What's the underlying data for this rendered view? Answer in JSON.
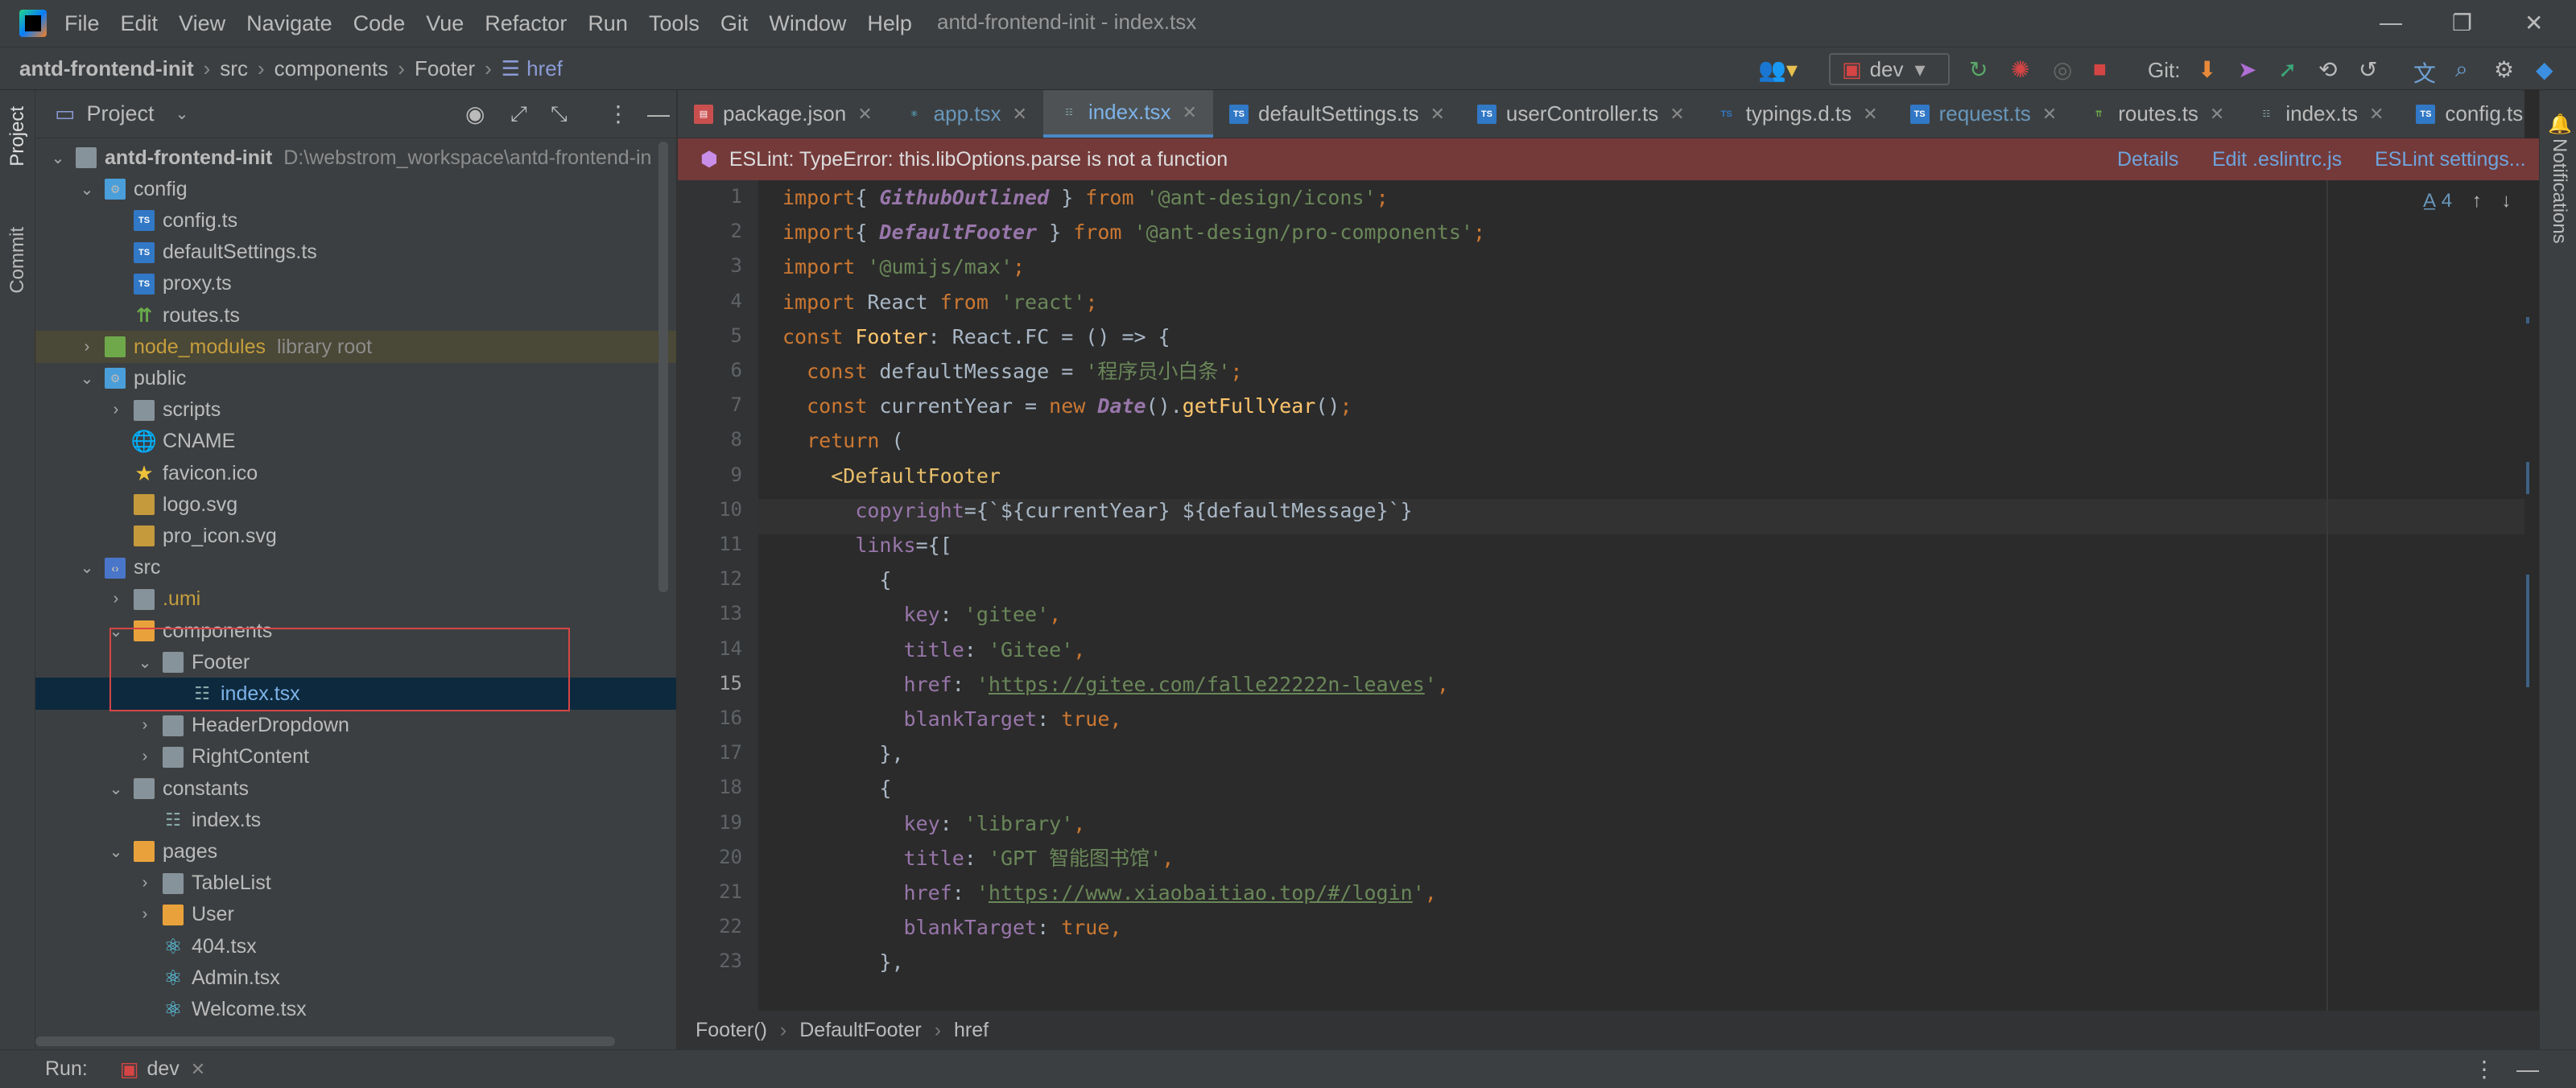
{
  "menubar": {
    "items": [
      "File",
      "Edit",
      "View",
      "Navigate",
      "Code",
      "Vue",
      "Refactor",
      "Run",
      "Tools",
      "Git",
      "Window",
      "Help"
    ],
    "title": "antd-frontend-init - index.tsx"
  },
  "navbar": {
    "crumbs": [
      "antd-frontend-init",
      "src",
      "components",
      "Footer",
      "href"
    ],
    "branch": "dev",
    "git_label": "Git:"
  },
  "leftstrip": {
    "project_tab": "Project",
    "commit_tab": "Commit"
  },
  "rightstrip": {
    "notifications_tab": "Notifications"
  },
  "project": {
    "header": "Project",
    "tree": [
      {
        "label": "antd-frontend-init",
        "extra": "D:\\webstrom_workspace\\antd-frontend-in",
        "depth": 0,
        "arrow": "open",
        "icon": "folder",
        "bold": true
      },
      {
        "label": "config",
        "depth": 1,
        "arrow": "open",
        "icon": "folder-cfg"
      },
      {
        "label": "config.ts",
        "depth": 2,
        "icon": "ts"
      },
      {
        "label": "defaultSettings.ts",
        "depth": 2,
        "icon": "ts"
      },
      {
        "label": "proxy.ts",
        "depth": 2,
        "icon": "ts"
      },
      {
        "label": "routes.ts",
        "depth": 2,
        "icon": "route"
      },
      {
        "label": "node_modules",
        "extra": "library root",
        "depth": 1,
        "arrow": "closed",
        "icon": "folder-green",
        "style": "lib"
      },
      {
        "label": "public",
        "depth": 1,
        "arrow": "open",
        "icon": "folder-cfg"
      },
      {
        "label": "scripts",
        "depth": 2,
        "arrow": "closed",
        "icon": "folder"
      },
      {
        "label": "CNAME",
        "depth": 2,
        "icon": "cname"
      },
      {
        "label": "favicon.ico",
        "depth": 2,
        "icon": "star"
      },
      {
        "label": "logo.svg",
        "depth": 2,
        "icon": "svg"
      },
      {
        "label": "pro_icon.svg",
        "depth": 2,
        "icon": "svg"
      },
      {
        "label": "src",
        "depth": 1,
        "arrow": "open",
        "icon": "folder-src"
      },
      {
        "label": ".umi",
        "depth": 2,
        "arrow": "closed",
        "icon": "folder",
        "style": "orange"
      },
      {
        "label": "components",
        "depth": 2,
        "arrow": "open",
        "icon": "folder-orange"
      },
      {
        "label": "Footer",
        "depth": 3,
        "arrow": "open",
        "icon": "folder"
      },
      {
        "label": "index.tsx",
        "depth": 4,
        "icon": "lines",
        "style": "sel"
      },
      {
        "label": "HeaderDropdown",
        "depth": 3,
        "arrow": "closed",
        "icon": "folder"
      },
      {
        "label": "RightContent",
        "depth": 3,
        "arrow": "closed",
        "icon": "folder"
      },
      {
        "label": "constants",
        "depth": 2,
        "arrow": "open",
        "icon": "folder"
      },
      {
        "label": "index.ts",
        "depth": 3,
        "icon": "lines"
      },
      {
        "label": "pages",
        "depth": 2,
        "arrow": "open",
        "icon": "folder-orange"
      },
      {
        "label": "TableList",
        "depth": 3,
        "arrow": "closed",
        "icon": "folder"
      },
      {
        "label": "User",
        "depth": 3,
        "arrow": "closed",
        "icon": "folder-orange"
      },
      {
        "label": "404.tsx",
        "depth": 3,
        "icon": "react"
      },
      {
        "label": "Admin.tsx",
        "depth": 3,
        "icon": "react"
      },
      {
        "label": "Welcome.tsx",
        "depth": 3,
        "icon": "react"
      }
    ]
  },
  "tabs": [
    {
      "label": "package.json",
      "icon": "json"
    },
    {
      "label": "app.tsx",
      "icon": "react",
      "style": "blue"
    },
    {
      "label": "index.tsx",
      "icon": "lines",
      "style": "active"
    },
    {
      "label": "defaultSettings.ts",
      "icon": "ts"
    },
    {
      "label": "userController.ts",
      "icon": "ts"
    },
    {
      "label": "typings.d.ts",
      "icon": "dts"
    },
    {
      "label": "request.ts",
      "icon": "ts",
      "style": "blue"
    },
    {
      "label": "routes.ts",
      "icon": "route"
    },
    {
      "label": "index.ts",
      "icon": "lines"
    },
    {
      "label": "config.ts",
      "icon": "ts"
    }
  ],
  "eslint": {
    "message": "ESLint: TypeError: this.libOptions.parse is not a function",
    "details": "Details",
    "edit": "Edit .eslintrc.js",
    "settings": "ESLint settings..."
  },
  "editor": {
    "inspections_count": "4",
    "current_line": 15,
    "line_numbers": [
      "1",
      "2",
      "3",
      "4",
      "5",
      "6",
      "7",
      "8",
      "9",
      "10",
      "11",
      "12",
      "13",
      "14",
      "15",
      "16",
      "17",
      "18",
      "19",
      "20",
      "21",
      "22",
      "23"
    ]
  },
  "code_lines": [
    [
      [
        "k",
        "import"
      ],
      [
        "",
        "{ "
      ],
      [
        "i",
        "GithubOutlined"
      ],
      [
        "",
        " } "
      ],
      [
        "k",
        "from"
      ],
      [
        "",
        " "
      ],
      [
        "s",
        "'@ant-design/icons'"
      ],
      [
        "k",
        ";"
      ]
    ],
    [
      [
        "k",
        "import"
      ],
      [
        "",
        "{ "
      ],
      [
        "i",
        "DefaultFooter"
      ],
      [
        "",
        " } "
      ],
      [
        "k",
        "from"
      ],
      [
        "",
        " "
      ],
      [
        "s",
        "'@ant-design/pro-components'"
      ],
      [
        "k",
        ";"
      ]
    ],
    [
      [
        "k",
        "import"
      ],
      [
        "",
        " "
      ],
      [
        "s",
        "'@umijs/max'"
      ],
      [
        "k",
        ";"
      ]
    ],
    [
      [
        "k",
        "import"
      ],
      [
        "",
        " React "
      ],
      [
        "k",
        "from"
      ],
      [
        "",
        " "
      ],
      [
        "s",
        "'react'"
      ],
      [
        "k",
        ";"
      ]
    ],
    [
      [
        "k",
        "const"
      ],
      [
        "",
        " "
      ],
      [
        "f",
        "Footer"
      ],
      [
        "",
        ": React.FC = () => {"
      ]
    ],
    [
      [
        "",
        "  "
      ],
      [
        "k",
        "const"
      ],
      [
        "",
        " defaultMessage = "
      ],
      [
        "s",
        "'程序员小白条'"
      ],
      [
        "k",
        ";"
      ]
    ],
    [
      [
        "",
        "  "
      ],
      [
        "k",
        "const"
      ],
      [
        "",
        " currentYear = "
      ],
      [
        "k",
        "new"
      ],
      [
        "",
        " "
      ],
      [
        "i",
        "Date"
      ],
      [
        "",
        "()."
      ],
      [
        "f",
        "getFullYear"
      ],
      [
        "",
        "()"
      ],
      [
        "k",
        ";"
      ]
    ],
    [
      [
        "",
        "  "
      ],
      [
        "k",
        "return"
      ],
      [
        "",
        " ("
      ]
    ],
    [
      [
        "",
        "    "
      ],
      [
        "t",
        "<DefaultFooter"
      ]
    ],
    [
      [
        "",
        "      "
      ],
      [
        "p",
        "copyright"
      ],
      [
        "",
        "={`${currentYear} ${defaultMessage}`}"
      ]
    ],
    [
      [
        "",
        "      "
      ],
      [
        "p",
        "links"
      ],
      [
        "",
        "={["
      ]
    ],
    [
      [
        "",
        "        {"
      ]
    ],
    [
      [
        "",
        "          "
      ],
      [
        "p",
        "key"
      ],
      [
        "",
        ": "
      ],
      [
        "s",
        "'gitee'"
      ],
      [
        "k",
        ","
      ]
    ],
    [
      [
        "",
        "          "
      ],
      [
        "p",
        "title"
      ],
      [
        "",
        ": "
      ],
      [
        "s",
        "'Gitee'"
      ],
      [
        "k",
        ","
      ]
    ],
    [
      [
        "",
        "          "
      ],
      [
        "p",
        "href"
      ],
      [
        "",
        ": "
      ],
      [
        "s",
        "'"
      ],
      [
        "su",
        "https://gitee.com/falle22222n-leaves"
      ],
      [
        "s",
        "'"
      ],
      [
        "k",
        ","
      ]
    ],
    [
      [
        "",
        "          "
      ],
      [
        "p",
        "blankTarget"
      ],
      [
        "",
        ": "
      ],
      [
        "k",
        "true"
      ],
      [
        "k",
        ","
      ]
    ],
    [
      [
        "",
        "        },"
      ]
    ],
    [
      [
        "",
        "        {"
      ]
    ],
    [
      [
        "",
        "          "
      ],
      [
        "p",
        "key"
      ],
      [
        "",
        ": "
      ],
      [
        "s",
        "'library'"
      ],
      [
        "k",
        ","
      ]
    ],
    [
      [
        "",
        "          "
      ],
      [
        "p",
        "title"
      ],
      [
        "",
        ": "
      ],
      [
        "s",
        "'GPT 智能图书馆'"
      ],
      [
        "k",
        ","
      ]
    ],
    [
      [
        "",
        "          "
      ],
      [
        "p",
        "href"
      ],
      [
        "",
        ": "
      ],
      [
        "s",
        "'"
      ],
      [
        "su",
        "https://www.xiaobaitiao.top/#/login"
      ],
      [
        "s",
        "'"
      ],
      [
        "k",
        ","
      ]
    ],
    [
      [
        "",
        "          "
      ],
      [
        "p",
        "blankTarget"
      ],
      [
        "",
        ": "
      ],
      [
        "k",
        "true"
      ],
      [
        "k",
        ","
      ]
    ],
    [
      [
        "",
        "        },"
      ]
    ]
  ],
  "breadcrumb": [
    "Footer()",
    "DefaultFooter",
    "href"
  ],
  "bottombar": {
    "run_label": "Run:",
    "run_config": "dev"
  }
}
